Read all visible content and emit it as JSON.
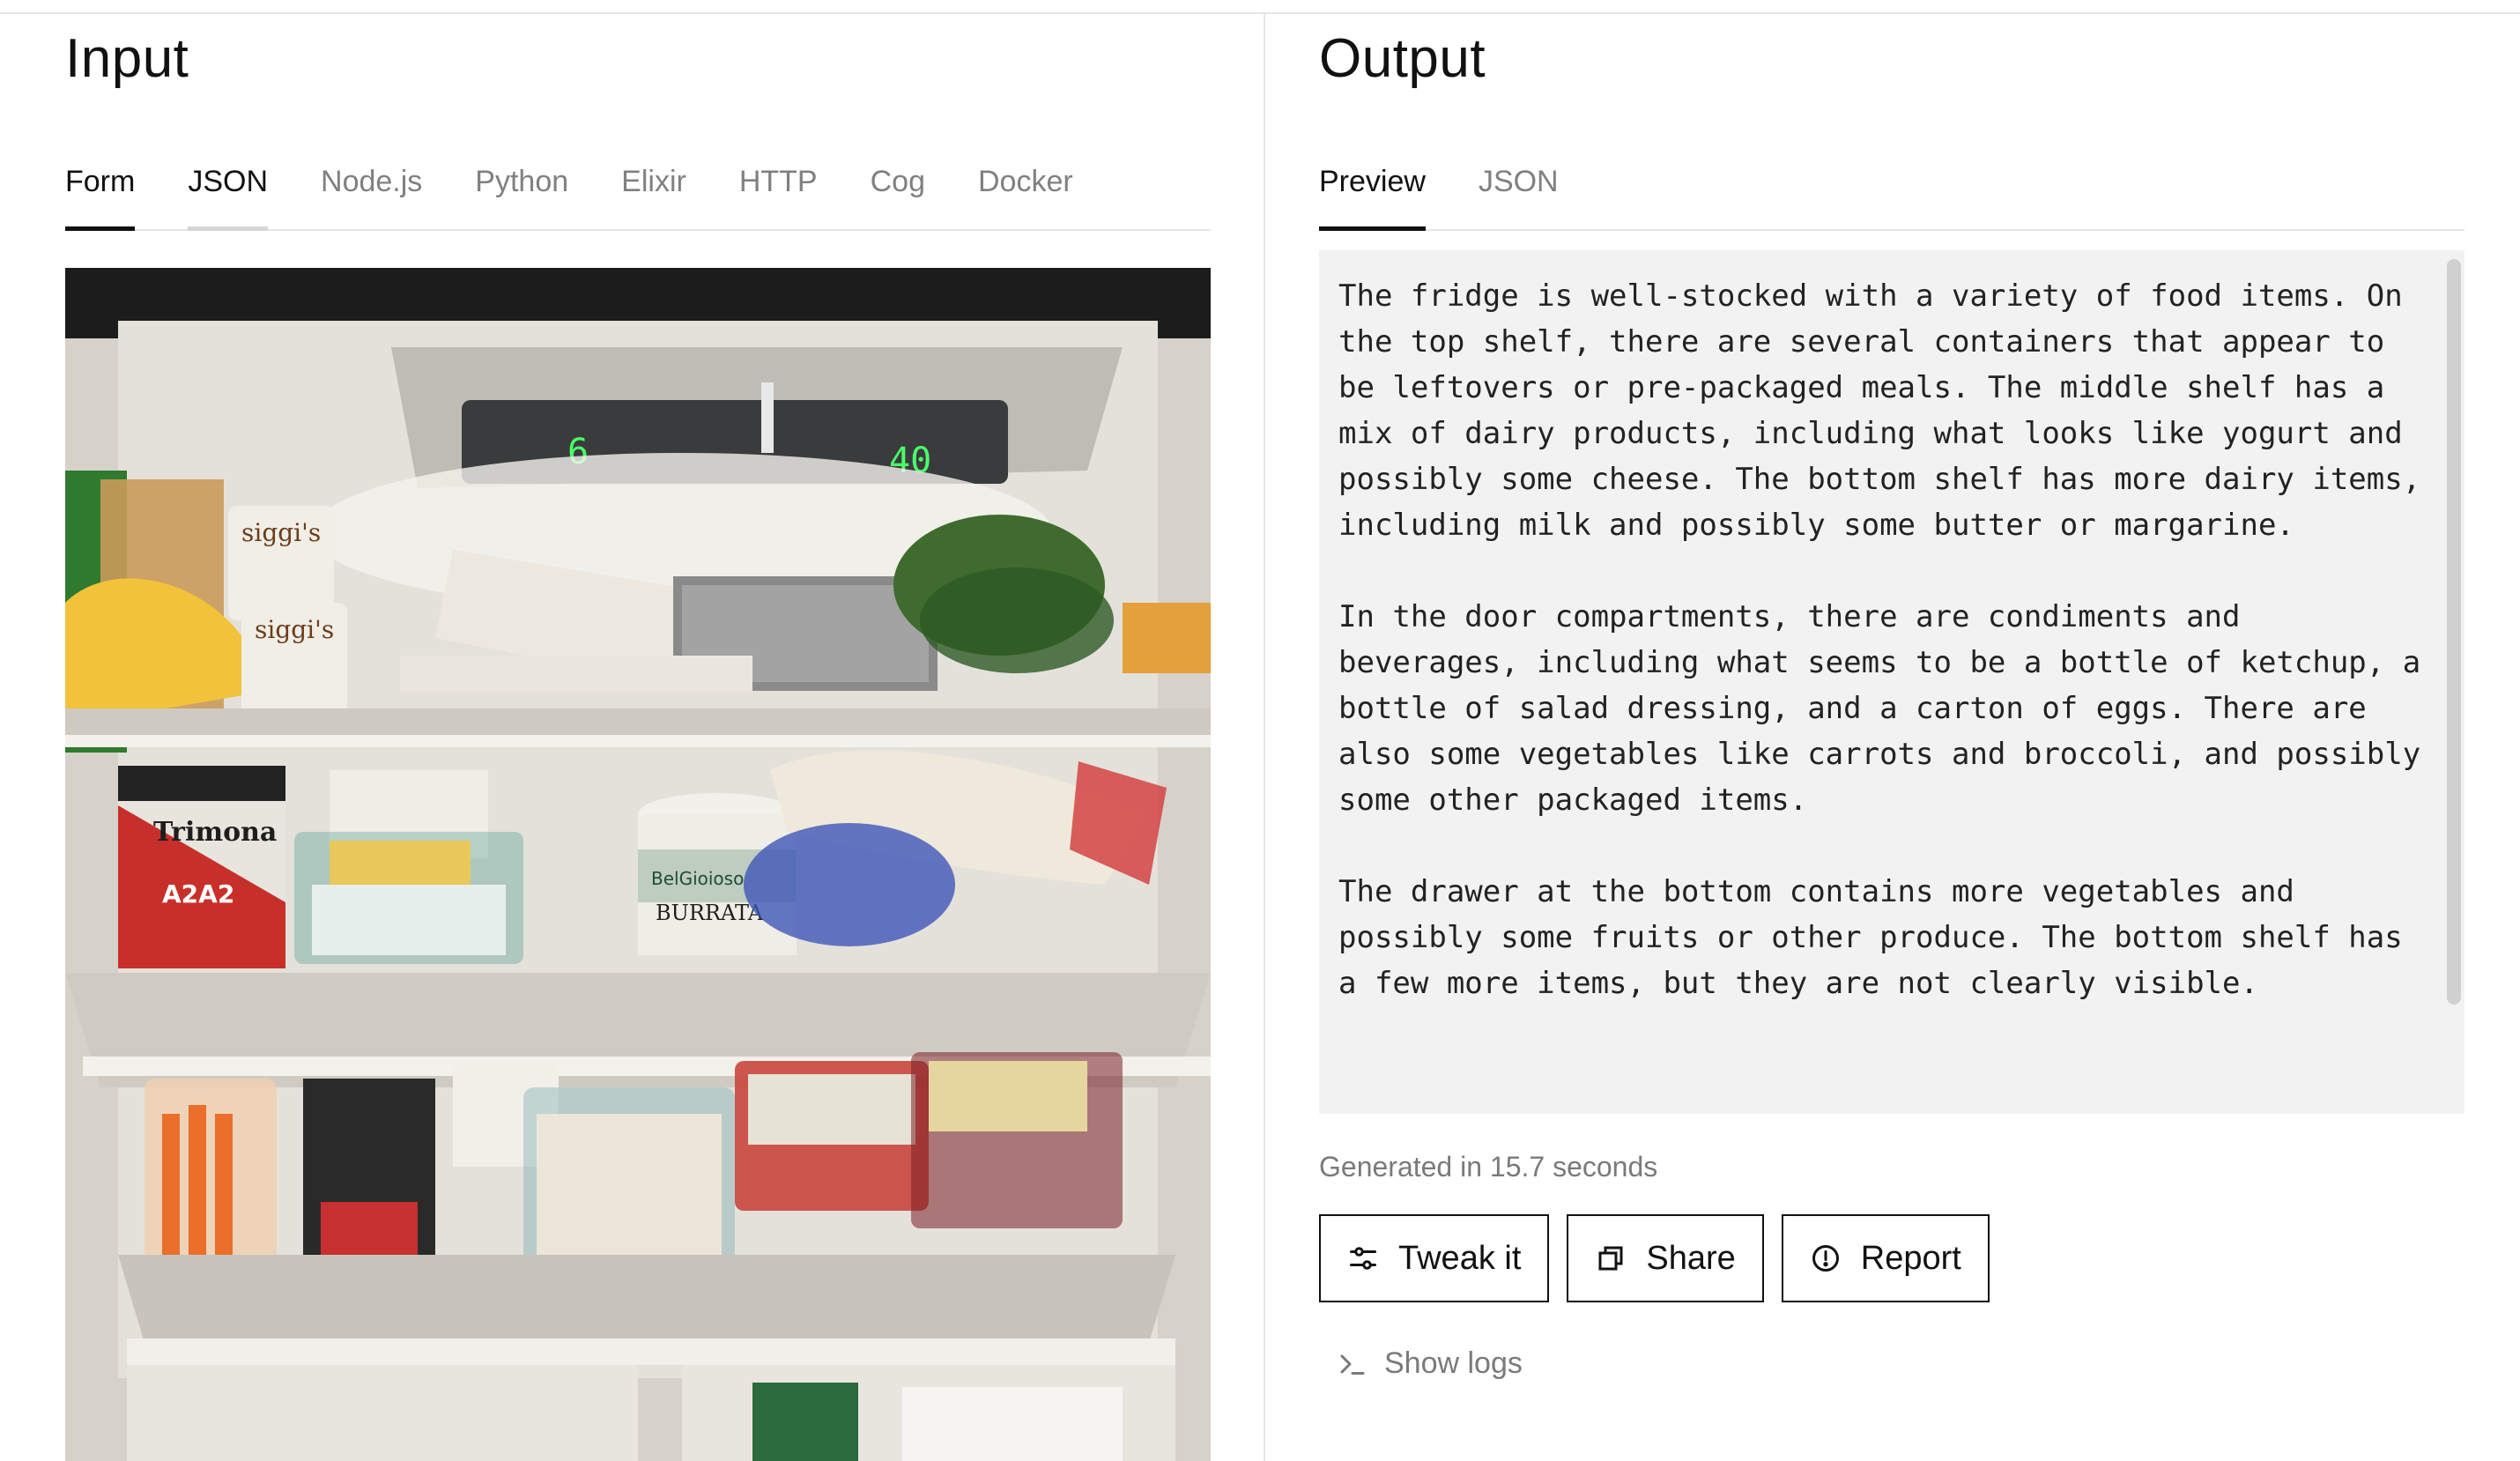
{
  "input": {
    "title": "Input",
    "tabs": [
      {
        "label": "Form",
        "active": true
      },
      {
        "label": "JSON",
        "active": false
      },
      {
        "label": "Node.js",
        "active": false
      },
      {
        "label": "Python",
        "active": false
      },
      {
        "label": "Elixir",
        "active": false
      },
      {
        "label": "HTTP",
        "active": false
      },
      {
        "label": "Cog",
        "active": false
      },
      {
        "label": "Docker",
        "active": false
      }
    ],
    "image": {
      "display_left": "6",
      "display_right": "40",
      "yogurt_brand": "siggi's",
      "yogurt_brand_2": "siggi's",
      "tub_brand": "Trimona",
      "tub_label": "A2A2",
      "cheese_brand": "BelGioioso",
      "cheese_label": "BURRATA"
    }
  },
  "output": {
    "title": "Output",
    "tabs": [
      {
        "label": "Preview",
        "active": true
      },
      {
        "label": "JSON",
        "active": false
      }
    ],
    "text": "The fridge is well-stocked with a variety of food items. On the top shelf, there are several containers that appear to be leftovers or pre-packaged meals. The middle shelf has a mix of dairy products, including what looks like yogurt and possibly some cheese. The bottom shelf has more dairy items, including milk and possibly some butter or margarine.\n\nIn the door compartments, there are condiments and beverages, including what seems to be a bottle of ketchup, a bottle of salad dressing, and a carton of eggs. There are also some vegetables like carrots and broccoli, and possibly some other packaged items.\n\nThe drawer at the bottom contains more vegetables and possibly some fruits or other produce. The bottom shelf has a few more items, but they are not clearly visible.",
    "generated": "Generated in 15.7 seconds",
    "buttons": {
      "tweak": "Tweak it",
      "share": "Share",
      "report": "Report"
    },
    "logs": "Show logs"
  },
  "icons": {
    "tweak": "sliders-icon",
    "share": "copy-icon",
    "report": "alert-circle-icon",
    "logs": "terminal-icon"
  }
}
